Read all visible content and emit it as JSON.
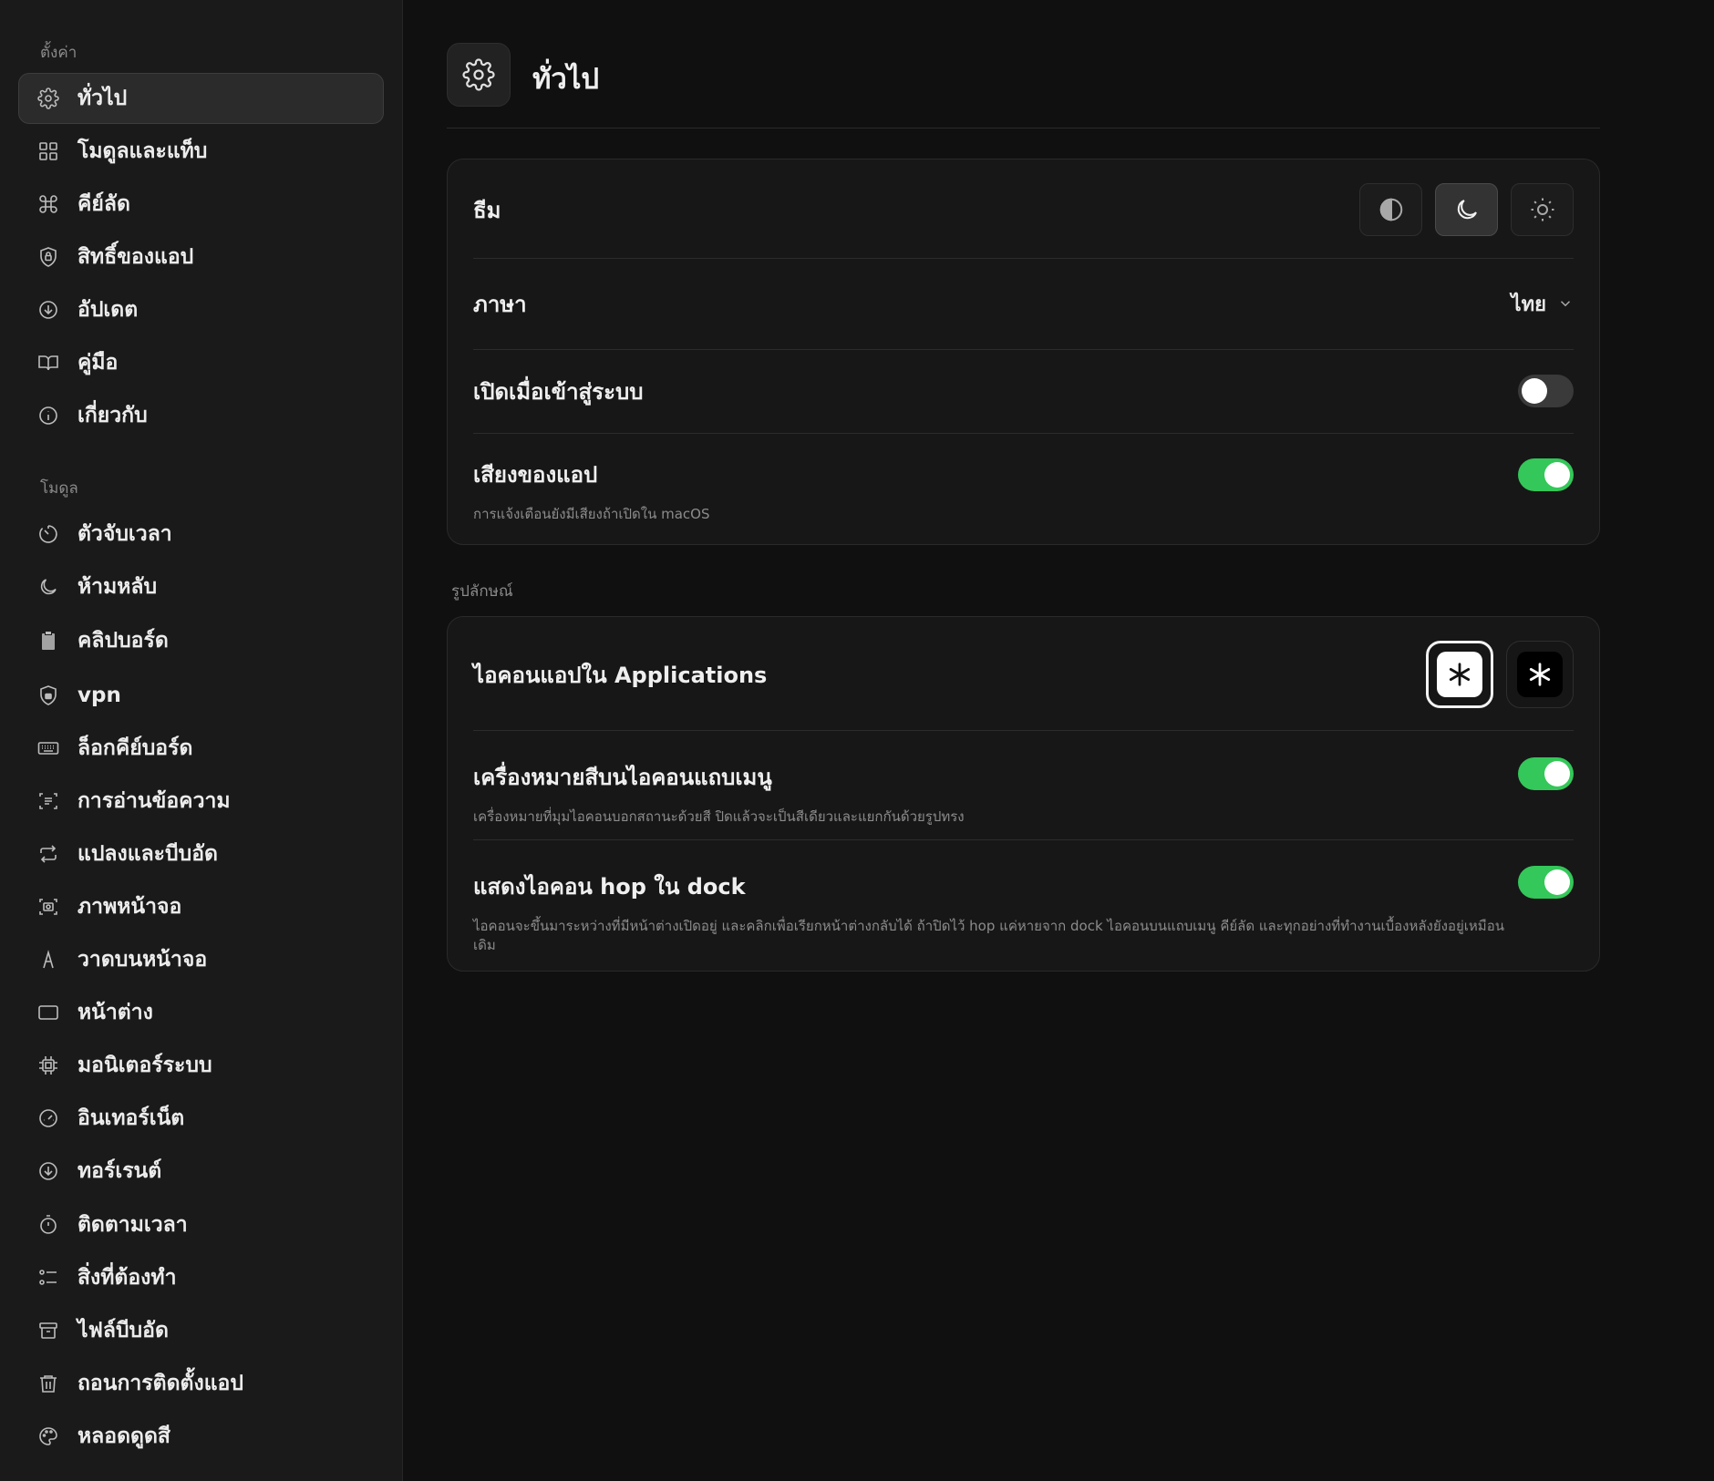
{
  "sidebar": {
    "settings_label": "ตั้งค่า",
    "settings_items": [
      {
        "label": "ทั่วไป",
        "icon": "gear-icon",
        "active": true
      },
      {
        "label": "โมดูลและแท็บ",
        "icon": "grid-icon"
      },
      {
        "label": "คีย์ลัด",
        "icon": "command-icon"
      },
      {
        "label": "สิทธิ์ของแอป",
        "icon": "shield-lock-icon"
      },
      {
        "label": "อัปเดต",
        "icon": "download-circle-icon"
      },
      {
        "label": "คู่มือ",
        "icon": "book-icon"
      },
      {
        "label": "เกี่ยวกับ",
        "icon": "info-icon"
      }
    ],
    "modules_label": "โมดูล",
    "module_items": [
      {
        "label": "ตัวจับเวลา",
        "icon": "timer-icon"
      },
      {
        "label": "ห้ามหลับ",
        "icon": "moon-icon"
      },
      {
        "label": "คลิปบอร์ด",
        "icon": "clipboard-icon"
      },
      {
        "label": "vpn",
        "icon": "shield-lock-icon"
      },
      {
        "label": "ล็อกคีย์บอร์ด",
        "icon": "keyboard-icon"
      },
      {
        "label": "การอ่านข้อความ",
        "icon": "text-scan-icon"
      },
      {
        "label": "แปลงและบีบอัด",
        "icon": "convert-icon"
      },
      {
        "label": "ภาพหน้าจอ",
        "icon": "screenshot-icon"
      },
      {
        "label": "วาดบนหน้าจอ",
        "icon": "draw-icon"
      },
      {
        "label": "หน้าต่าง",
        "icon": "window-icon"
      },
      {
        "label": "มอนิเตอร์ระบบ",
        "icon": "cpu-icon"
      },
      {
        "label": "อินเทอร์เน็ต",
        "icon": "gauge-icon"
      },
      {
        "label": "ทอร์เรนต์",
        "icon": "download-circle-icon"
      },
      {
        "label": "ติดตามเวลา",
        "icon": "stopwatch-icon"
      },
      {
        "label": "สิ่งที่ต้องทำ",
        "icon": "checklist-icon"
      },
      {
        "label": "ไฟล์บีบอัด",
        "icon": "archive-icon"
      },
      {
        "label": "ถอนการติดตั้งแอป",
        "icon": "trash-icon"
      },
      {
        "label": "หลอดดูดสี",
        "icon": "palette-icon"
      }
    ]
  },
  "header": {
    "title": "ทั่วไป"
  },
  "general": {
    "theme_label": "ธีม",
    "theme_selected": "dark",
    "language_label": "ภาษา",
    "language_value": "ไทย",
    "launch_label": "เปิดเมื่อเข้าสู่ระบบ",
    "launch_on": false,
    "sound_label": "เสียงของแอป",
    "sound_desc": "การแจ้งเตือนยังมีเสียงถ้าเปิดใน macOS",
    "sound_on": true
  },
  "appearance": {
    "section_label": "รูปลักษณ์",
    "app_icon_label": "ไอคอนแอปใน Applications",
    "app_icon_selected": "light",
    "menubar_label": "เครื่องหมายสีบนไอคอนแถบเมนู",
    "menubar_desc": "เครื่องหมายที่มุมไอคอนบอกสถานะด้วยสี ปิดแล้วจะเป็นสีเดียวและแยกกันด้วยรูปทรง",
    "menubar_on": true,
    "dock_label": "แสดงไอคอน hop ใน dock",
    "dock_desc": "ไอคอนจะขึ้นมาระหว่างที่มีหน้าต่างเปิดอยู่ และคลิกเพื่อเรียกหน้าต่างกลับได้ ถ้าปิดไว้ hop แค่หายจาก dock ไอคอนบนแถบเมนู คีย์ลัด และทุกอย่างที่ทำงานเบื้องหลังยังอยู่เหมือนเดิม",
    "dock_on": true
  },
  "colors": {
    "accent_green": "#34c759",
    "background": "#101010",
    "sidebar": "#1a1a1a"
  }
}
